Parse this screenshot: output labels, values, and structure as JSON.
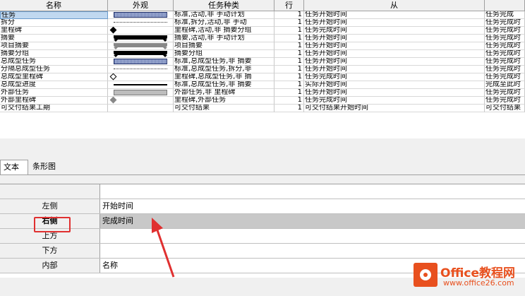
{
  "grid": {
    "columns": [
      "名称",
      "外观",
      "任务种类",
      "行",
      "从",
      ""
    ],
    "rows": [
      {
        "name": "任务",
        "app": "hatch",
        "kind": "标准,活动,非 手动计划",
        "row": "1",
        "from": "任务开始时间",
        "to": "任务完成",
        "selected": true
      },
      {
        "name": "拆分",
        "app": "dots",
        "kind": "标准,拆分,活动,非 手动",
        "row": "1",
        "from": "任务开始时间",
        "to": "任务完成时"
      },
      {
        "name": "里程碑",
        "app": "dia",
        "kind": "里程碑,活动,非 摘要分组",
        "row": "1",
        "from": "任务完成时间",
        "to": "任务完成时"
      },
      {
        "name": "摘要",
        "app": "sum",
        "kind": "摘要,活动,非 手动计划",
        "row": "1",
        "from": "任务开始时间",
        "to": "任务完成时"
      },
      {
        "name": "项目摘要",
        "app": "sumgray",
        "kind": "项目摘要",
        "row": "1",
        "from": "任务开始时间",
        "to": "任务完成时"
      },
      {
        "name": "摘要分组",
        "app": "sum",
        "kind": "摘要分组",
        "row": "1",
        "from": "任务开始时间",
        "to": "任务完成时"
      },
      {
        "name": "总成型任务",
        "app": "hatch",
        "kind": "标准,总成型任务,非 摘要",
        "row": "1",
        "from": "任务开始时间",
        "to": "任务完成时"
      },
      {
        "name": "分隔总成型任务",
        "app": "dots",
        "kind": "标准,总成型任务,拆分,非",
        "row": "1",
        "from": "任务开始时间",
        "to": "任务完成时"
      },
      {
        "name": "总成型里程碑",
        "app": "diaopen",
        "kind": "里程碑,总成型任务,非 摘",
        "row": "1",
        "from": "任务完成时间",
        "to": "任务完成时"
      },
      {
        "name": "总成型进度",
        "app": "line",
        "kind": "标准,总成型任务,非 摘要",
        "row": "1",
        "from": "实际开始时间",
        "to": "完成至此时"
      },
      {
        "name": "外部任务",
        "app": "gray",
        "kind": "外部任务,非 里程碑",
        "row": "1",
        "from": "任务开始时间",
        "to": "任务完成时"
      },
      {
        "name": "外部里程碑",
        "app": "diagray",
        "kind": "里程碑,外部任务",
        "row": "1",
        "from": "任务完成时间",
        "to": "任务完成时"
      },
      {
        "name": "可交付结果工期",
        "app": "none",
        "kind": "可交付结果",
        "row": "1",
        "from": "可交付结果开始时间",
        "to": "可交付结果"
      }
    ]
  },
  "tabs": [
    "文本",
    "条形图"
  ],
  "active_tab": 0,
  "properties": [
    {
      "label": "",
      "value": ""
    },
    {
      "label": "左侧",
      "value": "开始时间"
    },
    {
      "label": "右侧",
      "value": "完成时间",
      "selected": true
    },
    {
      "label": "上方",
      "value": ""
    },
    {
      "label": "下方",
      "value": ""
    },
    {
      "label": "内部",
      "value": "名称"
    }
  ],
  "logo": {
    "name": "Office教程网",
    "url": "www.office26.com"
  },
  "colors": {
    "highlight_box": "#e03030",
    "selected_row": "#c8c8c8",
    "logo_orange": "#e8501e"
  }
}
